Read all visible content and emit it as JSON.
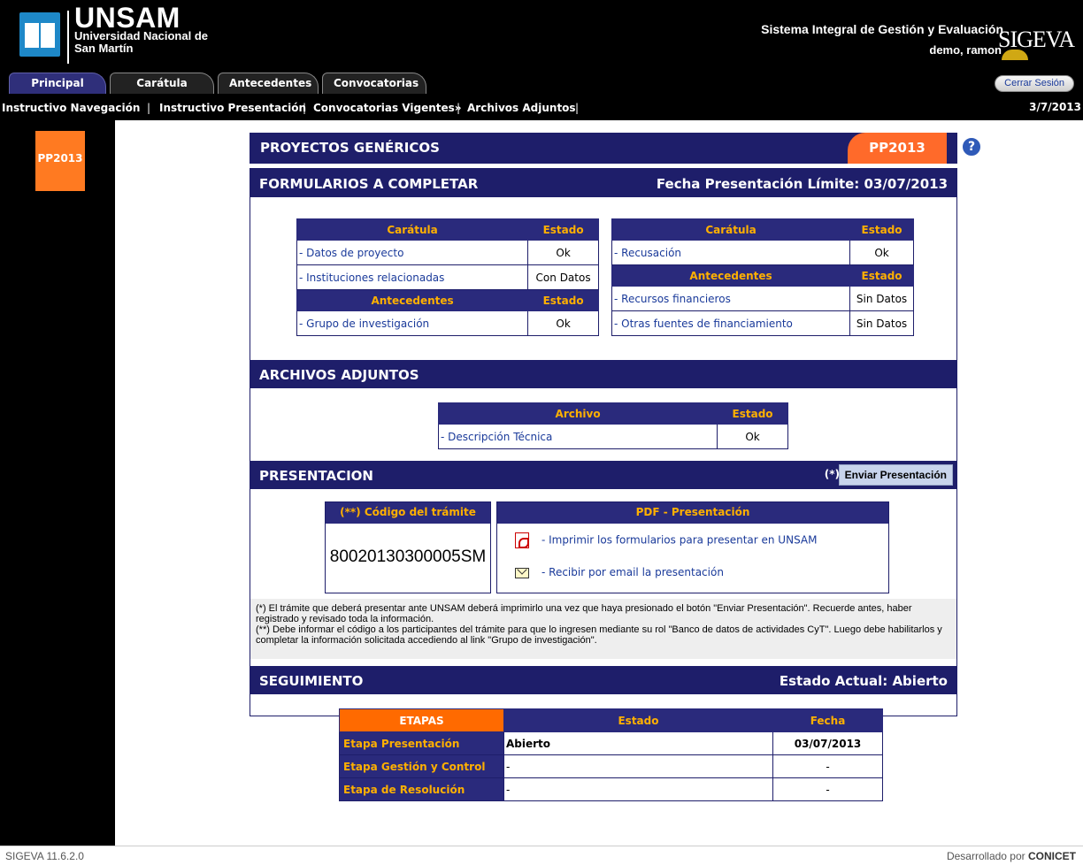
{
  "header": {
    "uni_short": "UNSAM",
    "uni_line1": "Universidad Nacional de",
    "uni_line2": "San Martín",
    "system_title": "Sistema Integral de Gestión y Evaluación",
    "user": "demo, ramon",
    "sigeva_logo": "SIGEVA"
  },
  "tabs": [
    {
      "label": "Principal",
      "active": true
    },
    {
      "label": "Carátula"
    },
    {
      "label": "Antecedentes"
    },
    {
      "label": "Convocatorias"
    }
  ],
  "logout_label": "Cerrar Sesión",
  "subnav": [
    "Instructivo Navegación",
    "Instructivo Presentación",
    "Convocatorias Vigentes»",
    "Archivos Adjuntos"
  ],
  "date": "3/7/2013",
  "sidebar": {
    "badge": "PP2013"
  },
  "page": {
    "title": "PROYECTOS GENÉRICOS",
    "badge": "PP2013",
    "help": "?"
  },
  "formularios": {
    "heading": "FORMULARIOS A COMPLETAR",
    "deadline_label": "Fecha Presentación Límite:",
    "deadline": "03/07/2013",
    "left": {
      "caratula_header": "Carátula",
      "estado_header": "Estado",
      "caratula_rows": [
        {
          "item": "- Datos de proyecto",
          "state": "Ok"
        },
        {
          "item": "- Instituciones relacionadas",
          "state": "Con Datos"
        }
      ],
      "antecedentes_header": "Antecedentes",
      "antecedentes_rows": [
        {
          "item": "- Grupo de investigación",
          "state": "Ok"
        }
      ]
    },
    "right": {
      "caratula_header": "Carátula",
      "estado_header": "Estado",
      "caratula_rows": [
        {
          "item": "- Recusación",
          "state": "Ok"
        }
      ],
      "antecedentes_header": "Antecedentes",
      "antecedentes_rows": [
        {
          "item": "- Recursos financieros",
          "state": "Sin Datos"
        },
        {
          "item": "- Otras fuentes de financiamiento",
          "state": "Sin Datos"
        }
      ]
    }
  },
  "adjuntos": {
    "heading": "ARCHIVOS ADJUNTOS",
    "archivo_header": "Archivo",
    "estado_header": "Estado",
    "rows": [
      {
        "item": "- Descripción Técnica",
        "state": "Ok"
      }
    ]
  },
  "presentacion": {
    "heading": "PRESENTACION",
    "note_marker": "(*)",
    "submit_label": "Enviar Presentación",
    "code_header": "(**) Código del trámite",
    "code": "80020130300005SM",
    "pdf_header": "PDF - Presentación",
    "print_link": "- Imprimir los formularios para presentar en UNSAM",
    "email_link": "- Recibir por email la presentación",
    "note1": "(*) El trámite que deberá presentar ante UNSAM deberá imprimirlo una vez que haya presionado el botón \"Enviar Presentación\". Recuerde antes, haber registrado y revisado toda la información.",
    "note2": "(**) Debe informar el código a los participantes del trámite para que lo ingresen mediante su rol \"Banco de datos de actividades CyT\". Luego debe habilitarlos y completar la información solicitada accediendo al link \"Grupo de investigación\"."
  },
  "seguimiento": {
    "heading": "SEGUIMIENTO",
    "state_label": "Estado Actual:",
    "state": "Abierto",
    "col_etapas": "ETAPAS",
    "col_estado": "Estado",
    "col_fecha": "Fecha",
    "rows": [
      {
        "stage": "Etapa Presentación",
        "estado": "Abierto",
        "fecha": "03/07/2013"
      },
      {
        "stage": "Etapa Gestión y Control",
        "estado": "-",
        "fecha": "-"
      },
      {
        "stage": "Etapa de Resolución",
        "estado": "-",
        "fecha": "-"
      }
    ]
  },
  "footer": {
    "version": "SIGEVA 11.6.2.0",
    "developed_prefix": "Desarrollado por",
    "developed_by": "CONICET"
  }
}
